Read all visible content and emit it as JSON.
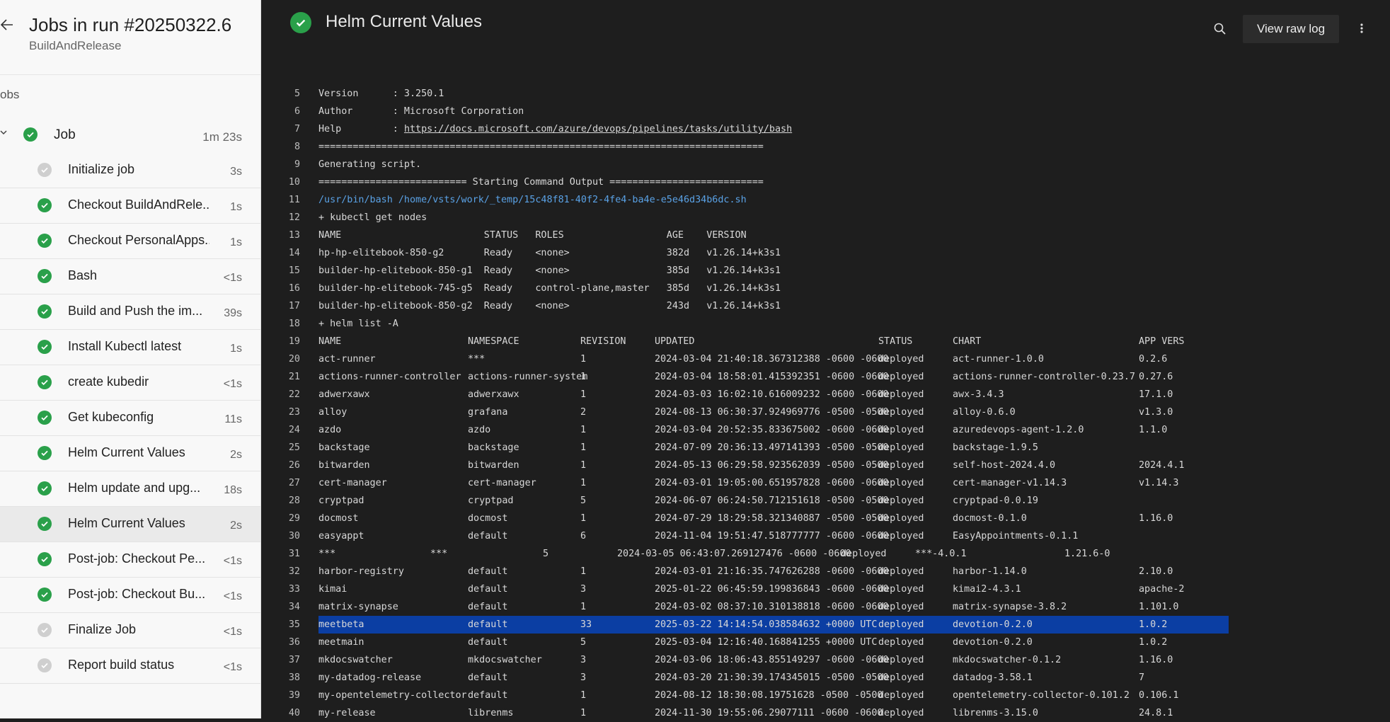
{
  "sidebar": {
    "title": "Jobs in run #20250322.6",
    "subtitle": "BuildAndRelease",
    "jobs_label": "obs",
    "job": {
      "label": "Job",
      "duration": "1m 23s"
    },
    "steps": [
      {
        "label": "Initialize job",
        "duration": "3s",
        "status": "skipped"
      },
      {
        "label": "Checkout BuildAndRele...",
        "duration": "1s",
        "status": "success"
      },
      {
        "label": "Checkout PersonalApps...",
        "duration": "1s",
        "status": "success"
      },
      {
        "label": "Bash",
        "duration": "<1s",
        "status": "success"
      },
      {
        "label": "Build and Push the im...",
        "duration": "39s",
        "status": "success"
      },
      {
        "label": "Install Kubectl latest",
        "duration": "1s",
        "status": "success"
      },
      {
        "label": "create kubedir",
        "duration": "<1s",
        "status": "success"
      },
      {
        "label": "Get kubeconfig",
        "duration": "11s",
        "status": "success"
      },
      {
        "label": "Helm Current Values",
        "duration": "2s",
        "status": "success"
      },
      {
        "label": "Helm update and upg...",
        "duration": "18s",
        "status": "success"
      },
      {
        "label": "Helm Current Values",
        "duration": "2s",
        "status": "success",
        "selected": true
      },
      {
        "label": "Post-job: Checkout Pe...",
        "duration": "<1s",
        "status": "success"
      },
      {
        "label": "Post-job: Checkout Bu...",
        "duration": "<1s",
        "status": "success"
      },
      {
        "label": "Finalize Job",
        "duration": "<1s",
        "status": "skipped"
      },
      {
        "label": "Report build status",
        "duration": "<1s",
        "status": "skipped"
      }
    ]
  },
  "header": {
    "title": "Helm Current Values",
    "raw_log_label": "View raw log"
  },
  "colors": {
    "success": "#2aa04a",
    "skipped": "#cfcfcf",
    "highlight": "#0b3ea3",
    "link": "#5aa2e6"
  },
  "log": {
    "simple": [
      {
        "no": "5",
        "text": "Version      : 3.250.1"
      },
      {
        "no": "6",
        "text": "Author       : Microsoft Corporation"
      },
      {
        "no": "7",
        "pre": "Help         : ",
        "link": "https://docs.microsoft.com/azure/devops/pipelines/tasks/utility/bash"
      },
      {
        "no": "8",
        "text": "=============================================================================="
      },
      {
        "no": "9",
        "text": "Generating script."
      },
      {
        "no": "10",
        "text": "========================== Starting Command Output ==========================="
      },
      {
        "no": "11",
        "path": "/usr/bin/bash /home/vsts/work/_temp/15c48f81-40f2-4fe4-ba4e-e5e46d34b6dc.sh"
      },
      {
        "no": "12",
        "text": "+ kubectl get nodes"
      },
      {
        "no": "13",
        "text": "NAME                         STATUS   ROLES                  AGE    VERSION"
      },
      {
        "no": "14",
        "text": "hp-hp-elitebook-850-g2       Ready    <none>                 382d   v1.26.14+k3s1"
      },
      {
        "no": "15",
        "text": "builder-hp-elitebook-850-g1  Ready    <none>                 385d   v1.26.14+k3s1"
      },
      {
        "no": "16",
        "text": "builder-hp-elitebook-745-g5  Ready    control-plane,master   385d   v1.26.14+k3s1"
      },
      {
        "no": "17",
        "text": "builder-hp-elitebook-850-g2  Ready    <none>                 243d   v1.26.14+k3s1"
      },
      {
        "no": "18",
        "text": "+ helm list -A"
      }
    ],
    "helm_rows": [
      {
        "no": "19",
        "cols": [
          "NAME",
          "NAMESPACE",
          "REVISION",
          "UPDATED",
          "STATUS",
          "CHART",
          "APP VERS"
        ]
      },
      {
        "no": "20",
        "cols": [
          "act-runner",
          "***",
          "1",
          "2024-03-04 21:40:18.367312388 -0600 -0600",
          "deployed",
          "act-runner-1.0.0",
          "0.2.6"
        ]
      },
      {
        "no": "21",
        "cols": [
          "actions-runner-controller",
          "actions-runner-system",
          "1",
          "2024-03-04 18:58:01.415392351 -0600 -0600",
          "deployed",
          "actions-runner-controller-0.23.7",
          "0.27.6"
        ]
      },
      {
        "no": "22",
        "cols": [
          "adwerxawx",
          "adwerxawx",
          "1",
          "2024-03-03 16:02:10.616009232 -0600 -0600",
          "deployed",
          "awx-3.4.3",
          "17.1.0"
        ]
      },
      {
        "no": "23",
        "cols": [
          "alloy",
          "grafana",
          "2",
          "2024-08-13 06:30:37.924969776 -0500 -0500",
          "deployed",
          "alloy-0.6.0",
          "v1.3.0"
        ]
      },
      {
        "no": "24",
        "cols": [
          "azdo",
          "azdo",
          "1",
          "2024-03-04 20:52:35.833675002 -0600 -0600",
          "deployed",
          "azuredevops-agent-1.2.0",
          "1.1.0"
        ]
      },
      {
        "no": "25",
        "cols": [
          "backstage",
          "backstage",
          "1",
          "2024-07-09 20:36:13.497141393 -0500 -0500",
          "deployed",
          "backstage-1.9.5",
          ""
        ]
      },
      {
        "no": "26",
        "cols": [
          "bitwarden",
          "bitwarden",
          "1",
          "2024-05-13 06:29:58.923562039 -0500 -0500",
          "deployed",
          "self-host-2024.4.0",
          "2024.4.1"
        ]
      },
      {
        "no": "27",
        "cols": [
          "cert-manager",
          "cert-manager",
          "1",
          "2024-03-01 19:05:00.651957828 -0600 -0600",
          "deployed",
          "cert-manager-v1.14.3",
          "v1.14.3"
        ]
      },
      {
        "no": "28",
        "cols": [
          "cryptpad",
          "cryptpad",
          "5",
          "2024-06-07 06:24:50.712151618 -0500 -0500",
          "deployed",
          "cryptpad-0.0.19",
          ""
        ]
      },
      {
        "no": "29",
        "cols": [
          "docmost",
          "docmost",
          "1",
          "2024-07-29 18:29:58.321340887 -0500 -0500",
          "deployed",
          "docmost-0.1.0",
          "1.16.0"
        ]
      },
      {
        "no": "30",
        "cols": [
          "easyappt",
          "default",
          "6",
          "2024-11-04 19:51:47.518777777 -0600 -0600",
          "deployed",
          "EasyAppointments-0.1.1",
          ""
        ]
      },
      {
        "no": "31",
        "raw": true,
        "cols": [
          "***",
          "***",
          "5",
          "2024-03-05 06:43:07.269127476 -0600 -0600",
          "deployed",
          "***-4.0.1",
          "1.21.6-0"
        ]
      },
      {
        "no": "32",
        "cols": [
          "harbor-registry",
          "default",
          "1",
          "2024-03-01 21:16:35.747626288 -0600 -0600",
          "deployed",
          "harbor-1.14.0",
          "2.10.0"
        ]
      },
      {
        "no": "33",
        "cols": [
          "kimai",
          "default",
          "3",
          "2025-01-22 06:45:59.199836843 -0600 -0600",
          "deployed",
          "kimai2-4.3.1",
          "apache-2"
        ]
      },
      {
        "no": "34",
        "cols": [
          "matrix-synapse",
          "default",
          "1",
          "2024-03-02 08:37:10.310138818 -0600 -0600",
          "deployed",
          "matrix-synapse-3.8.2",
          "1.101.0"
        ]
      },
      {
        "no": "35",
        "highlight": true,
        "cols": [
          "meetbeta",
          "default",
          "33",
          "2025-03-22 14:14:54.038584632 +0000 UTC",
          "deployed",
          "devotion-0.2.0",
          "1.0.2"
        ]
      },
      {
        "no": "36",
        "cols": [
          "meetmain",
          "default",
          "5",
          "2025-03-04 12:16:40.168841255 +0000 UTC",
          "deployed",
          "devotion-0.2.0",
          "1.0.2"
        ]
      },
      {
        "no": "37",
        "cols": [
          "mkdocswatcher",
          "mkdocswatcher",
          "3",
          "2024-03-06 18:06:43.855149297 -0600 -0600",
          "deployed",
          "mkdocswatcher-0.1.2",
          "1.16.0"
        ]
      },
      {
        "no": "38",
        "cols": [
          "my-datadog-release",
          "default",
          "3",
          "2024-03-20 21:30:39.174345015 -0500 -0500",
          "deployed",
          "datadog-3.58.1",
          "7"
        ]
      },
      {
        "no": "39",
        "cols": [
          "my-opentelemetry-collector",
          "default",
          "1",
          "2024-08-12 18:30:08.19751628 -0500 -0500",
          "deployed",
          "opentelemetry-collector-0.101.2",
          "0.106.1"
        ]
      },
      {
        "no": "40",
        "cols": [
          "my-release",
          "librenms",
          "1",
          "2024-11-30 19:55:06.29077111 -0600 -0600",
          "deployed",
          "librenms-3.15.0",
          "24.8.1"
        ]
      }
    ]
  }
}
